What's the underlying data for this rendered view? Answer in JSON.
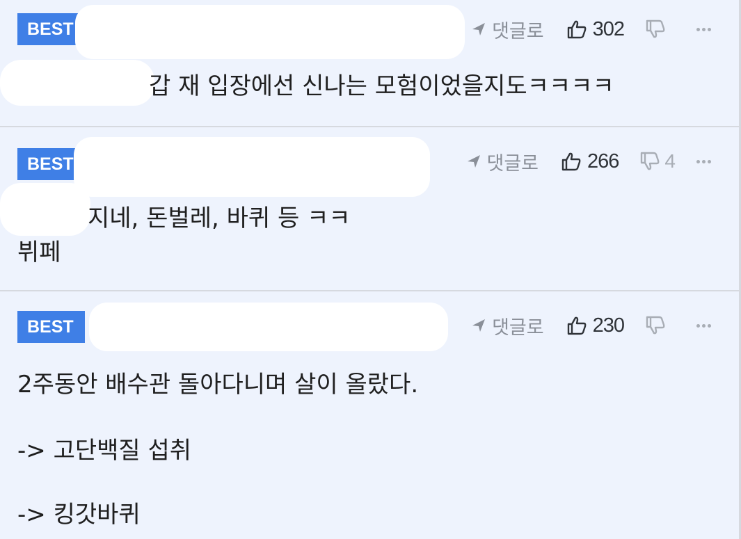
{
  "comments": [
    {
      "badge": "BEST",
      "reply_label": "댓글로",
      "likes": "302",
      "dislikes": "",
      "lines": [
        "",
        "갑 재 입장에선 신나는 모험이었을지도ㅋㅋㅋㅋ"
      ]
    },
    {
      "badge": "BEST",
      "reply_label": "댓글로",
      "likes": "266",
      "dislikes": "4",
      "lines": [
        "지네, 돈벌레, 바퀴 등 ㅋㅋ",
        "뷔페"
      ]
    },
    {
      "badge": "BEST",
      "reply_label": "댓글로",
      "likes": "230",
      "dislikes": "",
      "lines": [
        "2주동안 배수관 돌아다니며 살이 올랐다.",
        "-> 고단백질 섭취",
        "-> 킹갓바퀴"
      ]
    }
  ],
  "icons": {
    "reply": "reply-arrow-icon",
    "like": "thumbs-up-icon",
    "dislike": "thumbs-down-icon",
    "more": "more-icon"
  },
  "colors": {
    "badge": "#3f7fe6",
    "background": "#eef3fd"
  }
}
